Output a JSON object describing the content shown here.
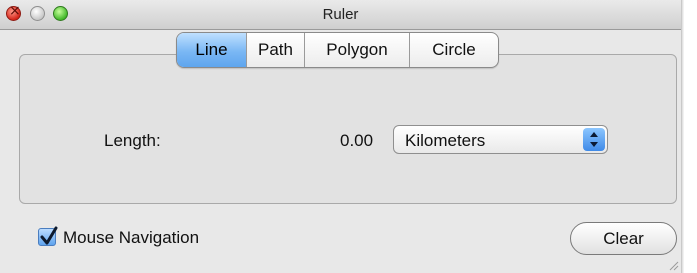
{
  "window": {
    "title": "Ruler",
    "controls": [
      "close-icon",
      "minimize-icon",
      "zoom-icon"
    ]
  },
  "tabs": [
    {
      "label": "Line",
      "active": true
    },
    {
      "label": "Path",
      "active": false
    },
    {
      "label": "Polygon",
      "active": false
    },
    {
      "label": "Circle",
      "active": false
    }
  ],
  "measurement": {
    "label": "Length:",
    "value": "0.00",
    "unit": "Kilometers"
  },
  "options": {
    "mouse_navigation_label": "Mouse Navigation",
    "mouse_navigation_checked": true
  },
  "actions": {
    "clear_label": "Clear"
  },
  "colors": {
    "accent": "#5ea5ee",
    "window_bg": "#e8e8e8"
  }
}
